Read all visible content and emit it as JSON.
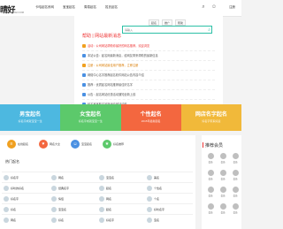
{
  "header": {
    "logo": "晴好",
    "logo_sub": "WWW.QINGHAO.COM",
    "nav": [
      "卡哈起名系网",
      "宝宝起名",
      "周易起名",
      "姓氏起名"
    ],
    "login": "注册"
  },
  "card": {
    "tabs": [
      "起名",
      "推广",
      "帮助"
    ],
    "search_placeholder": "请输入",
    "notice_title": "帮助 | 网站最新消息",
    "notices": [
      {
        "text": "活动：公司网站帮助你最好的网名推荐，欢迎浏览",
        "style": "hot2"
      },
      {
        "text": "本站公告：起名网最新消息，给网友带来帮助的最新信息",
        "style": "normal"
      },
      {
        "text": "注册：公司网站最佳用户推荐，立即注册",
        "style": "hot"
      },
      {
        "text": "网络中心名字推荐起名软件网站公告内容介绍",
        "style": "normal"
      },
      {
        "text": "推荐：优质起名网站推荐最佳好名字",
        "style": "normal"
      },
      {
        "text": "公告：起名网站优惠活动通知全新上线",
        "style": "normal"
      },
      {
        "text": "起名宝宝取名最新消息网站动态",
        "style": "normal"
      }
    ]
  },
  "banners": [
    {
      "title": "男宝起名",
      "sub": "好名字成就宝宝一生",
      "color": "#4db8e0"
    },
    {
      "title": "女宝起名",
      "sub": "好名字成就宝宝一生",
      "color": "#5cc96b"
    },
    {
      "title": "个性起名",
      "sub": "2015年最新起名",
      "color": "#f3673f"
    },
    {
      "title": "网店名字起名",
      "sub": "好名字带来好运",
      "color": "#f1b93a"
    }
  ],
  "features": [
    {
      "icon": "list-icon",
      "label": "在线起名",
      "color": "#f0a020"
    },
    {
      "icon": "heart-icon",
      "label": "网名大全",
      "color": "#f3673f"
    },
    {
      "icon": "user-icon",
      "label": "宝宝起名",
      "color": "#4a90e2"
    },
    {
      "icon": "star-icon",
      "label": "好名推荐",
      "color": "#5cc96b"
    }
  ],
  "section_title": "热门起名",
  "names": [
    [
      "好名字",
      "网名",
      "宝宝名",
      "美名"
    ],
    [
      "好听的好名",
      "经典名字",
      "起名",
      "个性名"
    ],
    [
      "好名字",
      "情侣",
      "网名",
      "个名"
    ],
    [
      "好名",
      "宝宝名",
      "起名",
      "好听名字"
    ],
    [
      "网名",
      "好名",
      "好名字",
      "宝名"
    ]
  ],
  "side": {
    "title": "推荐会员",
    "members": [
      "会员",
      "会员",
      "会员",
      "会员",
      "会员",
      "会员",
      "会员",
      "会员",
      "会员",
      "会员",
      "会员",
      "会员"
    ]
  }
}
